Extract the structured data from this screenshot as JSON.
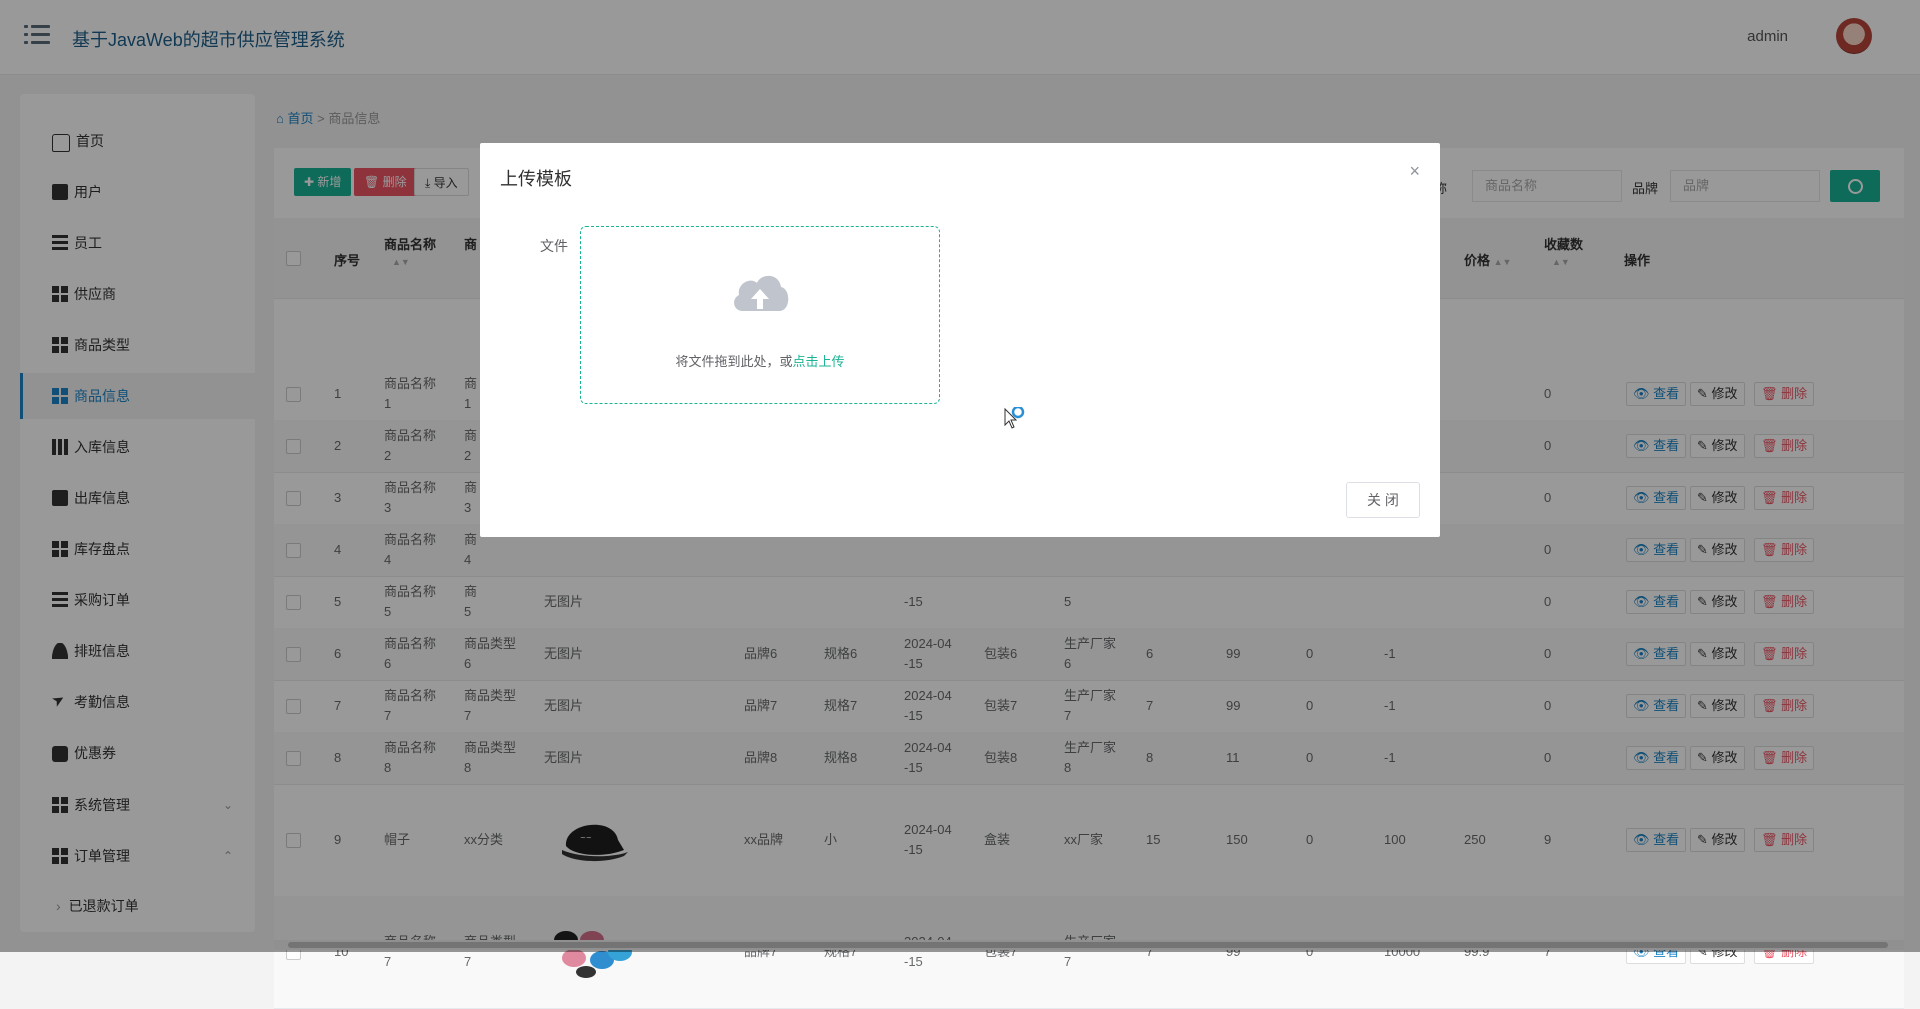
{
  "app": {
    "title": "基于JavaWeb的超市供应管理系统",
    "user": "admin"
  },
  "sidebar": {
    "items": [
      {
        "label": "首页",
        "icon": "home-icon"
      },
      {
        "label": "用户",
        "icon": "clipboard-icon"
      },
      {
        "label": "员工",
        "icon": "list-icon"
      },
      {
        "label": "供应商",
        "icon": "grid-icon"
      },
      {
        "label": "商品类型",
        "icon": "grid-icon"
      },
      {
        "label": "商品信息",
        "icon": "grid-icon",
        "active": true
      },
      {
        "label": "入库信息",
        "icon": "book-icon"
      },
      {
        "label": "出库信息",
        "icon": "clipboard-check-icon"
      },
      {
        "label": "库存盘点",
        "icon": "grid-icon"
      },
      {
        "label": "采购订单",
        "icon": "list-icon"
      },
      {
        "label": "排班信息",
        "icon": "user-icon"
      },
      {
        "label": "考勤信息",
        "icon": "paper-plane-icon"
      },
      {
        "label": "优惠券",
        "icon": "comment-icon"
      },
      {
        "label": "系统管理",
        "icon": "grid-icon",
        "chevron": "⌄"
      },
      {
        "label": "订单管理",
        "icon": "grid-icon",
        "chevron": "⌃"
      },
      {
        "label": "已退款订单",
        "icon": "chevron-right-icon"
      }
    ]
  },
  "breadcrumb": {
    "home": "首页",
    "sep": ">",
    "current": "商品信息"
  },
  "toolbar": {
    "add": "新增",
    "delete": "删除",
    "import": "导入"
  },
  "search": {
    "name_label": "称",
    "name_placeholder": "商品名称",
    "brand_label": "品牌",
    "brand_placeholder": "品牌"
  },
  "table": {
    "headers": {
      "index": "序号",
      "name": "商品名称",
      "type": "商",
      "price": "价格",
      "fav": "收藏数",
      "ops": "操作"
    },
    "ops": {
      "view": "查看",
      "edit": "修改",
      "del": "删除"
    },
    "rows": [
      {
        "idx": "1",
        "name": [
          "商品名称",
          "1"
        ],
        "type": [
          "商",
          "1"
        ],
        "fav": "0"
      },
      {
        "idx": "2",
        "name": [
          "商品名称",
          "2"
        ],
        "type": [
          "商",
          "2"
        ],
        "fav": "0"
      },
      {
        "idx": "3",
        "name": [
          "商品名称",
          "3"
        ],
        "type": [
          "商",
          "3"
        ],
        "fav": "0"
      },
      {
        "idx": "4",
        "name": [
          "商品名称",
          "4"
        ],
        "type": [
          "商",
          "4"
        ],
        "fav": "0"
      },
      {
        "idx": "5",
        "name": [
          "商品名称",
          "5"
        ],
        "type": [
          "商",
          "5"
        ],
        "img": "无图片",
        "date": "-15",
        "maker": "5",
        "fav": "0"
      },
      {
        "idx": "6",
        "name": [
          "商品名称",
          "6"
        ],
        "type": [
          "商品类型",
          "6"
        ],
        "img": "无图片",
        "brand": "品牌6",
        "spec": "规格6",
        "date": [
          "2024-04",
          "-15"
        ],
        "pack": "包装6",
        "maker": [
          "生产厂家",
          "6"
        ],
        "n1": "6",
        "n2": "99",
        "n3": "0",
        "n4": "-1",
        "fav": "0"
      },
      {
        "idx": "7",
        "name": [
          "商品名称",
          "7"
        ],
        "type": [
          "商品类型",
          "7"
        ],
        "img": "无图片",
        "brand": "品牌7",
        "spec": "规格7",
        "date": [
          "2024-04",
          "-15"
        ],
        "pack": "包装7",
        "maker": [
          "生产厂家",
          "7"
        ],
        "n1": "7",
        "n2": "99",
        "n3": "0",
        "n4": "-1",
        "fav": "0"
      },
      {
        "idx": "8",
        "name": [
          "商品名称",
          "8"
        ],
        "type": [
          "商品类型",
          "8"
        ],
        "img": "无图片",
        "brand": "品牌8",
        "spec": "规格8",
        "date": [
          "2024-04",
          "-15"
        ],
        "pack": "包装8",
        "maker": [
          "生产厂家",
          "8"
        ],
        "n1": "8",
        "n2": "11",
        "n3": "0",
        "n4": "-1",
        "fav": "0"
      },
      {
        "idx": "9",
        "name": [
          "帽子"
        ],
        "type": [
          "xx分类"
        ],
        "img": "cap-image",
        "brand": "xx品牌",
        "spec": "小",
        "date": [
          "2024-04",
          "-15"
        ],
        "pack": "盒装",
        "maker": [
          "xx厂家"
        ],
        "n1": "15",
        "n2": "150",
        "n3": "0",
        "n4": "100",
        "price": "250",
        "fav": "9"
      },
      {
        "idx": "10",
        "name": [
          "商品名称",
          "7"
        ],
        "type": [
          "商品类型",
          "7"
        ],
        "img": "sunglasses-image",
        "brand": "品牌7",
        "spec": "规格7",
        "date": [
          "2024-04",
          "-15"
        ],
        "pack": "包装7",
        "maker": [
          "生产厂家",
          "7"
        ],
        "n1": "7",
        "n2": "99",
        "n3": "0",
        "n4": "10000",
        "price": "99.9",
        "fav": "7"
      }
    ]
  },
  "modal": {
    "title": "上传模板",
    "close_icon": "×",
    "file_label": "文件",
    "drop_text": "将文件拖到此处，或",
    "drop_link": "点击上传",
    "close_button": "关 闭"
  },
  "colors": {
    "accent": "#1ab394",
    "primary": "#1c84c6",
    "danger": "#ed5565"
  }
}
